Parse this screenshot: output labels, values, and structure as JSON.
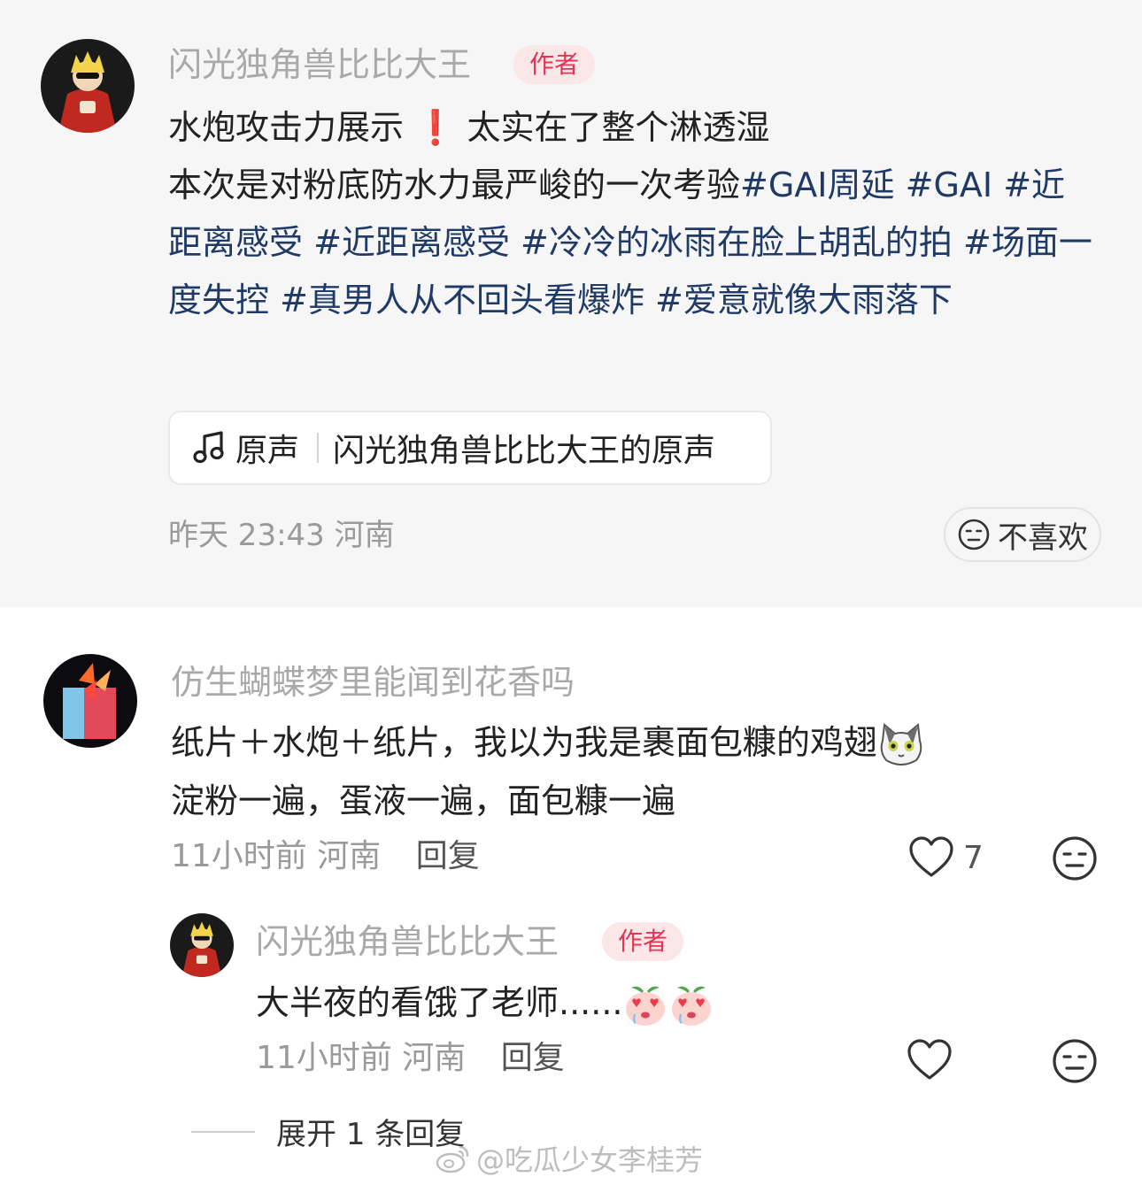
{
  "post": {
    "author_name": "闪光独角兽比比大王",
    "author_badge": "作者",
    "headline_part1": "水炮攻击力展示",
    "headline_emoji": "❗",
    "headline_part2": "太实在了整个淋透湿",
    "body_text": "本次是对粉底防水力最严峻的一次考验",
    "tags": [
      "#GAI周延",
      "#GAI",
      "#近距离感受",
      "#近距离感受",
      "#冷冷的冰雨在脸上胡乱的拍",
      "#场面一度失控",
      "#真男人从不回头看爆炸",
      "#爱意就像大雨落下"
    ],
    "sound_label": "原声",
    "sound_title": "闪光独角兽比比大王的原声",
    "time": "昨天 23:43",
    "location": "河南",
    "dislike_label": "不喜欢"
  },
  "comment": {
    "author_name": "仿生蝴蝶梦里能闻到花香吗",
    "line1": "纸片＋水炮＋纸片，我以为我是裹面包糠的鸡翅",
    "line2": "淀粉一遍，蛋液一遍，面包糠一遍",
    "time": "11小时前",
    "location": "河南",
    "reply_label": "回复",
    "like_count": "7"
  },
  "reply": {
    "author_name": "闪光独角兽比比大王",
    "author_badge": "作者",
    "text": "大半夜的看饿了老师......",
    "time": "11小时前",
    "location": "河南",
    "reply_label": "回复"
  },
  "expand_label": "展开 1 条回复",
  "watermark": "@吃瓜少女李桂芳",
  "colors": {
    "accent_badge": "#e63455",
    "tag_text": "#1f3a66",
    "card_bg": "#f6f6f6"
  },
  "icons": [
    "music-note-icon",
    "neutral-face-icon",
    "heart-icon",
    "cat-emoji",
    "heart-eyes-peach-emoji",
    "weibo-logo-icon"
  ]
}
